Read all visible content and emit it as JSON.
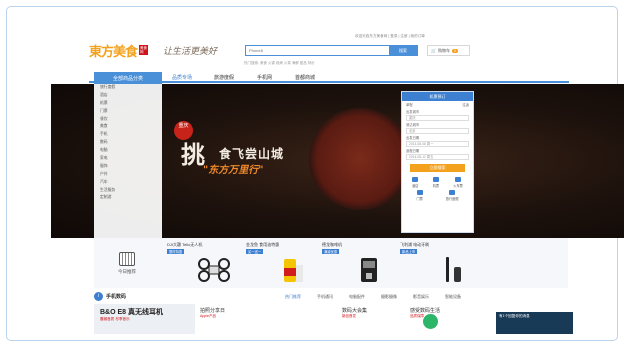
{
  "header": {
    "logo_text": "東方美食",
    "logo_badge": "美食网",
    "slogan": "让生活更美好",
    "top_links": "欢迎光临东方美食网 | 登录 | 注册 | 我的订单",
    "search_placeholder": "Phone8",
    "search_button": "搜索",
    "cart_label": "购物车",
    "cart_count": "0",
    "hot_words": "热门搜索:  美食 火锅 烧烤 川菜 海鲜 甜品 特价"
  },
  "nav": {
    "all_categories": "全部商品分类",
    "items": [
      "品质专场",
      "旅游度假",
      "手机网",
      "首都商城"
    ]
  },
  "sidebar": {
    "items": [
      "旅行度假",
      "酒店",
      "机票",
      "门票",
      "餐饮",
      "美食",
      "手机",
      "数码",
      "电脑",
      "家电",
      "服饰",
      "户外",
      "汽车",
      "生活服务",
      "定制游"
    ]
  },
  "banner": {
    "seal_text": "重庆",
    "big_char": "挑",
    "title": "食飞尝山城",
    "subtitle": "\"东方万里行\"",
    "booking": {
      "header": "机票预订",
      "trip_one": "单程",
      "trip_round": "往返",
      "from_label": "出发城市",
      "from_value": "重庆",
      "to_label": "到达城市",
      "to_value": "北京",
      "date_label": "出发日期",
      "date_value": "2014-08-08 周一",
      "ret_label": "返程日期",
      "ret_value": "2014-08-12 周五",
      "button": "立即搜索",
      "icons": [
        "酒店",
        "机票",
        "火车票",
        "门票",
        "旅行度假"
      ]
    }
  },
  "today": {
    "label": "今日推荐"
  },
  "promos": [
    {
      "title": "DJI大疆 Tello无人机",
      "tag": "限时特惠"
    },
    {
      "title": "金龙鱼 食用油特惠",
      "tag": "买一送一"
    },
    {
      "title": "德龙咖啡机",
      "tag": "满减优惠"
    },
    {
      "title": "飞利浦 电动牙刷",
      "tag": "新品上市"
    }
  ],
  "section": {
    "title": "手机数码",
    "tabs": [
      "热门推荐",
      "手机通讯",
      "电脑配件",
      "摄影摄像",
      "影音娱乐",
      "智能设备"
    ],
    "card_title": "B&O E8 真无线耳机",
    "card_sub": "震撼音质 尽享音乐",
    "minis": [
      {
        "title": "拍照分享日",
        "sub": "Apple产品"
      },
      {
        "title": "数码大会集",
        "sub": "新品首发"
      },
      {
        "title": "感受数码生活",
        "sub": "品质保障"
      }
    ]
  },
  "chat": {
    "label": "有1个回复你的消息"
  }
}
